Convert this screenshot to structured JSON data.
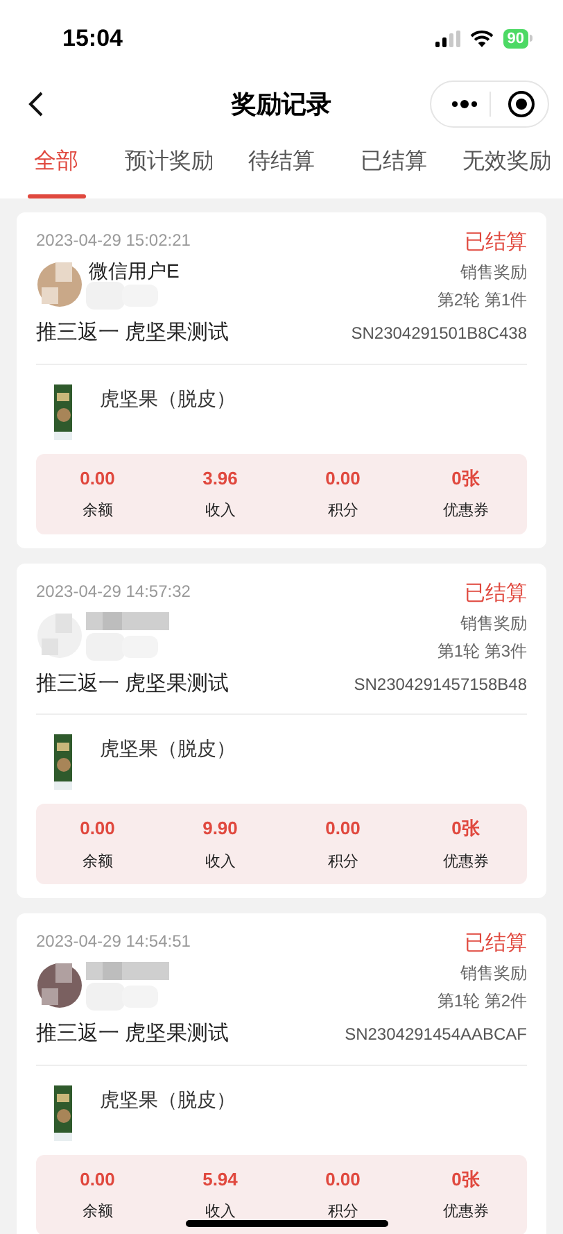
{
  "status_bar": {
    "time": "15:04",
    "battery": "90"
  },
  "nav": {
    "title": "奖励记录"
  },
  "tabs": [
    {
      "label": "全部",
      "selected": true
    },
    {
      "label": "预计奖励",
      "selected": false
    },
    {
      "label": "待结算",
      "selected": false
    },
    {
      "label": "已结算",
      "selected": false
    },
    {
      "label": "无效奖励",
      "selected": false
    }
  ],
  "records": [
    {
      "time": "2023-04-29 15:02:21",
      "status": "已结算",
      "user": "微信用户E",
      "type": "销售奖励",
      "round": "第2轮 第1件",
      "activity": "推三返一 虎坚果测试",
      "order_no": "SN2304291501B8C438",
      "product": "虎坚果（脱皮）",
      "stats": [
        {
          "value": "0.00",
          "label": "余额"
        },
        {
          "value": "3.96",
          "label": "收入"
        },
        {
          "value": "0.00",
          "label": "积分"
        },
        {
          "value": "0张",
          "label": "优惠券"
        }
      ]
    },
    {
      "time": "2023-04-29 14:57:32",
      "status": "已结算",
      "type": "销售奖励",
      "round": "第1轮 第3件",
      "activity": "推三返一 虎坚果测试",
      "order_no": "SN2304291457158B48",
      "product": "虎坚果（脱皮）",
      "stats": [
        {
          "value": "0.00",
          "label": "余额"
        },
        {
          "value": "9.90",
          "label": "收入"
        },
        {
          "value": "0.00",
          "label": "积分"
        },
        {
          "value": "0张",
          "label": "优惠券"
        }
      ]
    },
    {
      "time": "2023-04-29 14:54:51",
      "status": "已结算",
      "type": "销售奖励",
      "round": "第1轮 第2件",
      "activity": "推三返一 虎坚果测试",
      "order_no": "SN2304291454AABCAF",
      "product": "虎坚果（脱皮）",
      "stats": [
        {
          "value": "0.00",
          "label": "余额"
        },
        {
          "value": "5.94",
          "label": "收入"
        },
        {
          "value": "0.00",
          "label": "积分"
        },
        {
          "value": "0张",
          "label": "优惠券"
        }
      ]
    }
  ]
}
